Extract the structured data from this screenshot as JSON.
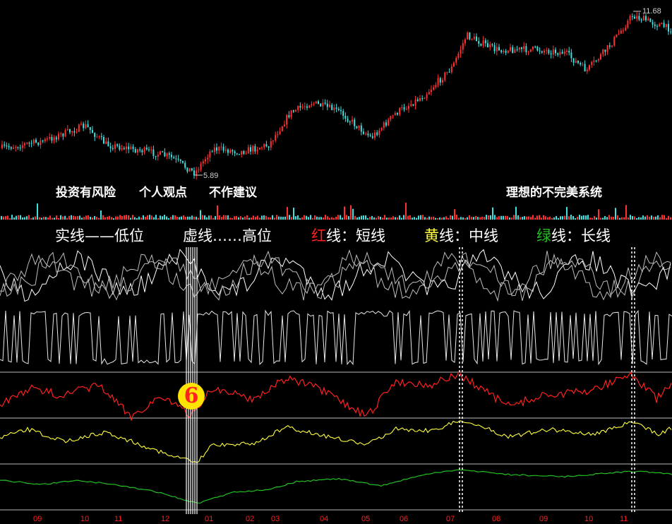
{
  "annotations": {
    "risk": "投资有风险",
    "personal": "个人观点",
    "no_advice": "不作建议",
    "system": "理想的不完美系统",
    "circle_mark": "6"
  },
  "price_labels": {
    "high": "11.68",
    "low": "5.89"
  },
  "legend": [
    {
      "text": "实线——低位",
      "color": "#ffffff"
    },
    {
      "text": "虚线……高位",
      "color": "#ffffff"
    },
    {
      "prefix": "红",
      "text": "线：短线",
      "prefix_color": "#ff2020"
    },
    {
      "prefix": "黄",
      "text": "线：中线",
      "prefix_color": "#ffff40"
    },
    {
      "prefix": "绿",
      "text": "线：长线",
      "prefix_color": "#20c020"
    }
  ],
  "x_axis_months": [
    "09",
    "10",
    "11",
    "12",
    "01",
    "02",
    "03",
    "04",
    "05",
    "06",
    "07",
    "08",
    "09",
    "10",
    "11"
  ],
  "colors": {
    "up": "#ff3030",
    "down": "#40e0e0",
    "short": "#ff2020",
    "mid": "#ffff40",
    "long": "#20c020",
    "osc": "#e8e8e8",
    "grid": "#bbbbbb"
  }
}
